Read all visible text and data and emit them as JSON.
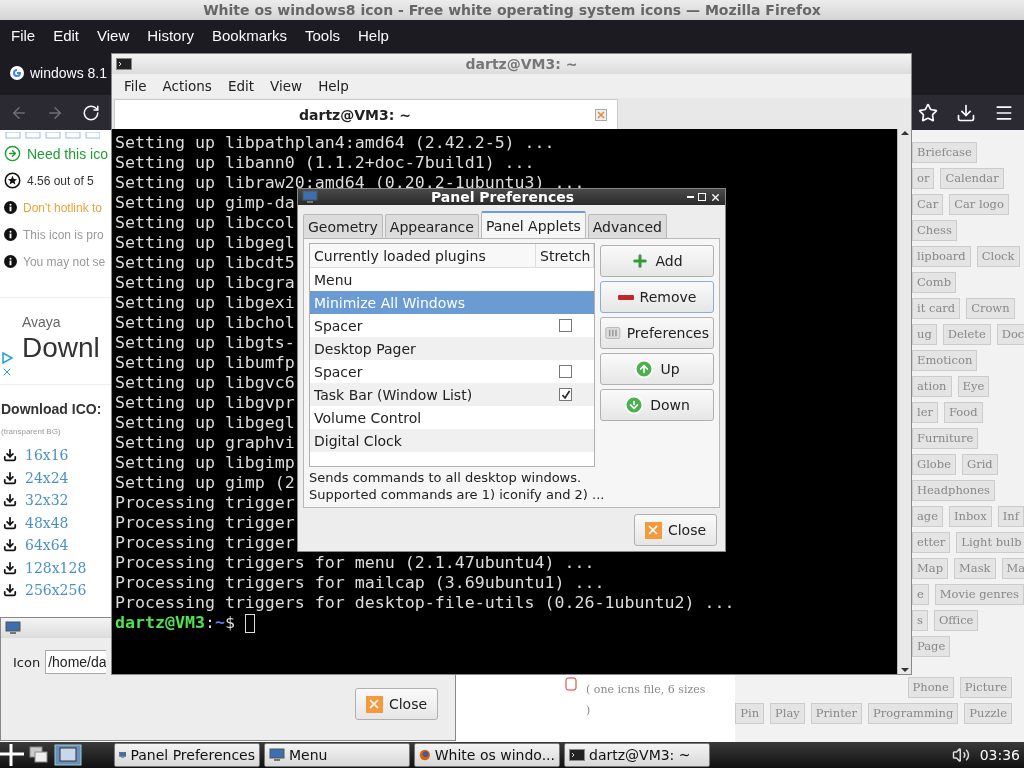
{
  "browser": {
    "title": "White os windows8 icon - Free white operating system icons — Mozilla Firefox",
    "menu": [
      "File",
      "Edit",
      "View",
      "History",
      "Bookmarks",
      "Tools",
      "Help"
    ],
    "tab": "windows 8.1",
    "notes": [
      {
        "kind": "download",
        "text": "Need this ico"
      },
      {
        "kind": "rating",
        "text": "4.56 out of 5"
      },
      {
        "kind": "warning",
        "text": "Don't hotlink to"
      },
      {
        "kind": "info",
        "text": "This icon is pro"
      },
      {
        "kind": "info",
        "text": "You may not se"
      }
    ],
    "ad": {
      "brand": "Avaya",
      "headline": "Downl"
    },
    "download_title": "Download ICO:",
    "download_note": "(transparent BG)",
    "sizes": [
      "16x16",
      "24x24",
      "32x32",
      "48x48",
      "64x64",
      "128x128",
      "256x256"
    ],
    "tag_rows": [
      [
        "Briefcase"
      ],
      [
        "or",
        "Calendar"
      ],
      [
        "Car",
        "Car logo"
      ],
      [
        "Chess"
      ],
      [
        "lipboard",
        "Clock"
      ],
      [
        "Comb"
      ],
      [
        "it card",
        "Crown"
      ],
      [
        "ug",
        "Delete",
        "Doc"
      ],
      [
        "Emoticon"
      ],
      [
        "ation",
        "Eye"
      ],
      [
        "ler",
        "Food"
      ],
      [
        "Furniture"
      ],
      [
        "Globe",
        "Grid"
      ],
      [
        "Headphones"
      ],
      [
        "age",
        "Inbox",
        "Inf"
      ],
      [
        "etter",
        "Light bulb"
      ],
      [
        "Map",
        "Mask",
        "Ma"
      ],
      [
        "e",
        "Movie genres"
      ],
      [
        "s",
        "Office"
      ],
      [
        "Page"
      ]
    ],
    "icns_note": [
      "( one icns file, 6 sizes",
      ")"
    ],
    "bottom_tag_rows": [
      [
        "Phone",
        "Picture"
      ],
      [
        "Pin",
        "Play",
        "Printer",
        "Programming",
        "Puzzle"
      ]
    ]
  },
  "icon_dialog": {
    "label": "Icon",
    "value": "/home/da",
    "close": "Close"
  },
  "terminal": {
    "title": "dartz@VM3: ~",
    "menu": [
      "File",
      "Actions",
      "Edit",
      "View",
      "Help"
    ],
    "tab": "dartz@VM3: ~",
    "lines": [
      "Setting up libpathplan4:amd64 (2.42.2-5) ...",
      "Setting up libann0 (1.1.2+doc-7build1) ...",
      "Setting up libraw20:amd64 (0.20.2-1ubuntu3) ...",
      "Setting up gimp-da",
      "Setting up libccol",
      "Setting up libgegl",
      "Setting up libcdt5",
      "Setting up libcgra",
      "Setting up libgexi",
      "Setting up libchol",
      "Setting up libgts-",
      "Setting up libumfp",
      "Setting up libgvc6",
      "Setting up libgvpr",
      "Setting up libgegl",
      "Setting up graphvi",
      "Setting up libgimp",
      "Setting up gimp (2",
      "Processing trigger",
      "Processing trigger",
      "Processing trigger",
      "Processing triggers for menu (2.1.47ubuntu4) ...",
      "Processing triggers for mailcap (3.69ubuntu1) ...",
      "Processing triggers for desktop-file-utils (0.26-1ubuntu2) ..."
    ],
    "prompt": {
      "user_host": "dartz@VM3",
      "separator": ":",
      "path": "~",
      "symbol": "$"
    }
  },
  "dialog": {
    "title": "Panel Preferences",
    "tabs": [
      {
        "label": "Geometry",
        "selected": false
      },
      {
        "label": "Appearance",
        "selected": false
      },
      {
        "label": "Panel Applets",
        "selected": true
      },
      {
        "label": "Advanced",
        "selected": false
      }
    ],
    "columns": [
      "Currently loaded plugins",
      "Stretch"
    ],
    "plugins": [
      {
        "name": "Menu",
        "kind": "plain",
        "selected": false
      },
      {
        "name": "Minimize All Windows",
        "kind": "plain",
        "selected": true
      },
      {
        "name": "Spacer",
        "kind": "checkbox",
        "checked": false,
        "selected": false
      },
      {
        "name": "Desktop Pager",
        "kind": "plain",
        "selected": false
      },
      {
        "name": "Spacer",
        "kind": "checkbox",
        "checked": false,
        "selected": false
      },
      {
        "name": "Task Bar (Window List)",
        "kind": "checkbox",
        "checked": true,
        "selected": false
      },
      {
        "name": "Volume Control",
        "kind": "plain",
        "selected": false
      },
      {
        "name": "Digital Clock",
        "kind": "plain",
        "selected": false
      }
    ],
    "description": [
      "Sends commands to all desktop windows.",
      "Supported commands are 1) iconify and 2) ..."
    ],
    "buttons": [
      {
        "kind": "add",
        "label": "Add"
      },
      {
        "kind": "remove",
        "label": "Remove"
      },
      {
        "kind": "preferences",
        "label": "Preferences"
      },
      {
        "kind": "up",
        "label": "Up"
      },
      {
        "kind": "down",
        "label": "Down"
      }
    ],
    "close": "Close"
  },
  "taskbar": {
    "tasks": [
      {
        "kind": "panel",
        "label": "Panel Preferences"
      },
      {
        "kind": "panel",
        "label": "Menu"
      },
      {
        "kind": "browser",
        "label": "White os windo..."
      },
      {
        "kind": "terminal",
        "label": "dartz@VM3: ~"
      }
    ],
    "clock": "03:36"
  }
}
